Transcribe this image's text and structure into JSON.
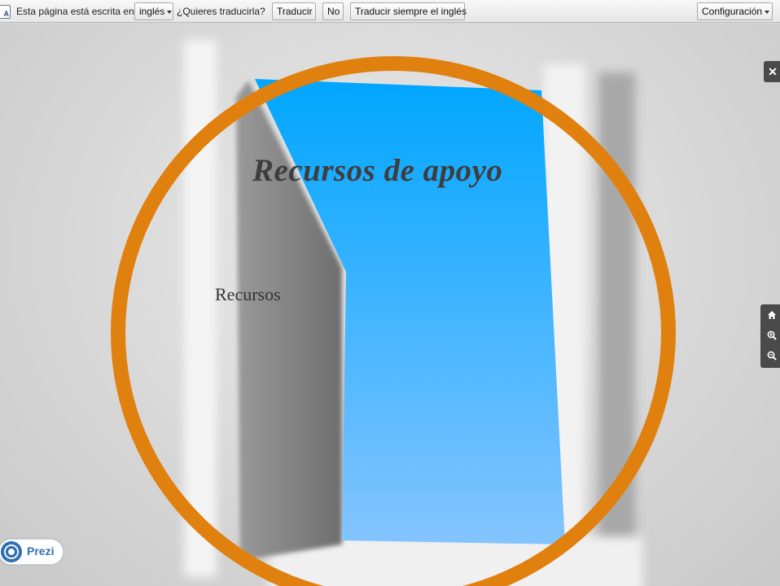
{
  "translate_bar": {
    "intro_text": "Esta página está escrita en",
    "language_select": "inglés",
    "question": "¿Quieres traducirla?",
    "translate_label": "Traducir",
    "no_label": "No",
    "always_label": "Traducir siempre el inglés",
    "settings_label": "Configuración"
  },
  "slide": {
    "title": "Recursos de apoyo",
    "subtitle": "Recursos"
  },
  "controls": {
    "close_glyph": "✕"
  },
  "brand": {
    "logo_text": "Prezi"
  },
  "colors": {
    "circle": "#e0800e",
    "sky_top": "#00a6ff",
    "sky_bottom": "#84c4ff",
    "control_bg": "#4a4a4a"
  }
}
